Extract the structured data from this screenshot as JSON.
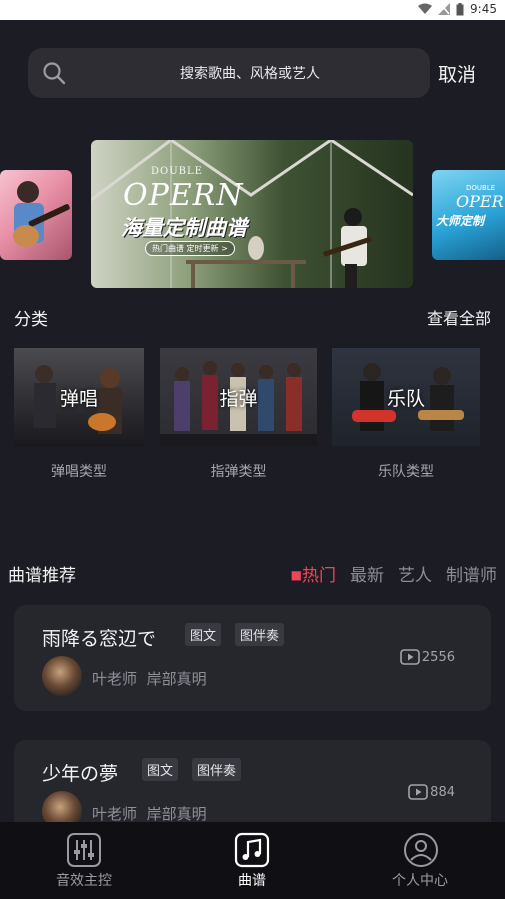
{
  "status_bar": {
    "time": "9:45"
  },
  "search": {
    "placeholder": "搜索歌曲、风格或艺人",
    "cancel_label": "取消"
  },
  "banner": {
    "brand_small": "DOUBLE",
    "brand": "OPERN",
    "headline": "海量定制曲谱",
    "pill": "热门曲谱 定时更新 >",
    "right_card_brand_small": "DOUBLE",
    "right_card_brand": "OPER",
    "right_card_headline": "大师定制"
  },
  "categories": {
    "title": "分类",
    "see_all": "查看全部",
    "items": [
      {
        "thumb_label": "弹唱",
        "caption": "弹唱类型"
      },
      {
        "thumb_label": "指弹",
        "caption": "指弹类型"
      },
      {
        "thumb_label": "乐队",
        "caption": "乐队类型"
      }
    ]
  },
  "recommend": {
    "title": "曲谱推荐",
    "tabs": [
      "热门",
      "最新",
      "艺人",
      "制谱师"
    ],
    "active_tab": "热门",
    "cards": [
      {
        "title": "雨降る窓辺で",
        "tags": [
          "图文",
          "图伴奏"
        ],
        "author": "叶老师",
        "artist": "岸部真明",
        "plays": "2556"
      },
      {
        "title": "少年の夢",
        "tags": [
          "图文",
          "图伴奏"
        ],
        "author": "叶老师",
        "artist": "岸部真明",
        "plays": "884"
      }
    ]
  },
  "bottom_nav": [
    {
      "label": "音效主控",
      "icon": "mixer-icon",
      "active": false
    },
    {
      "label": "曲谱",
      "icon": "music-note-icon",
      "active": true
    },
    {
      "label": "个人中心",
      "icon": "user-icon",
      "active": false
    }
  ],
  "colors": {
    "accent": "#f24459",
    "background": "#1c1c24",
    "card": "#26262d"
  }
}
